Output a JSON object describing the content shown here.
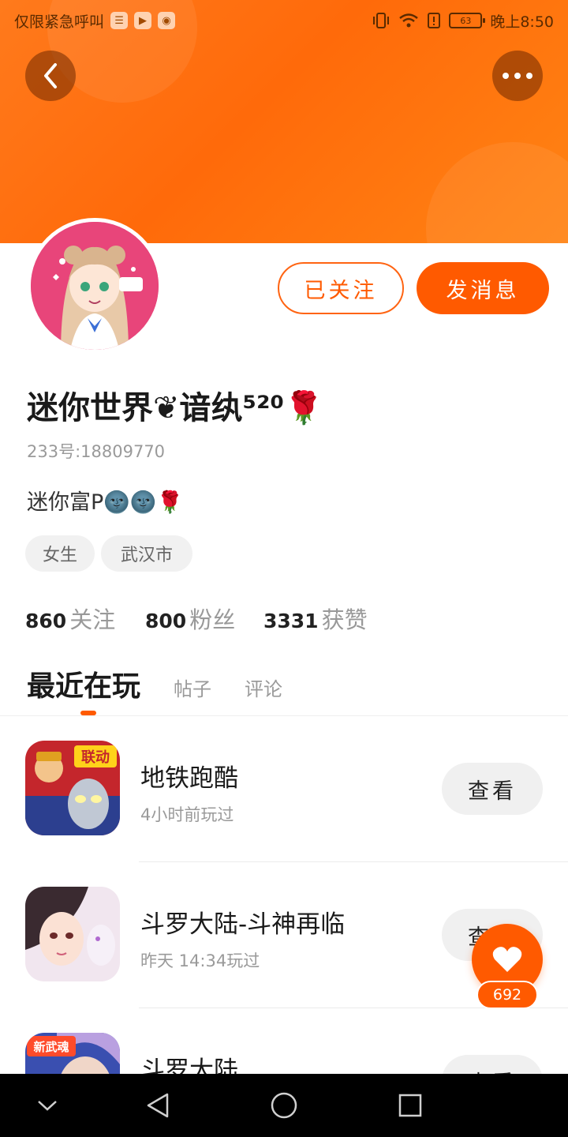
{
  "status_bar": {
    "carrier_text": "仅限紧急呼叫",
    "battery_level": "63",
    "time": "晚上8:50"
  },
  "profile": {
    "follow_state_label": "已关注",
    "message_label": "发消息",
    "nickname": "迷你世界❦谙纨⁵²⁰🌹",
    "uid": "233号:18809770",
    "bio": "迷你富P🌚🌚🌹",
    "tags": [
      "女生",
      "武汉市"
    ],
    "stats": {
      "following_count": "860",
      "following_label": "关注",
      "fans_count": "800",
      "fans_label": "粉丝",
      "likes_count": "3331",
      "likes_label": "获赞"
    }
  },
  "tabs": {
    "recent": "最近在玩",
    "posts": "帖子",
    "comments": "评论"
  },
  "games": [
    {
      "name": "地铁跑酷",
      "played": "4小时前玩过",
      "action": "查看",
      "icon_badge": "联动"
    },
    {
      "name": "斗罗大陆-斗神再临",
      "played": "昨天 14:34玩过",
      "action": "查看"
    },
    {
      "name": "斗罗大陆",
      "action": "查看",
      "icon_badge": "新武魂"
    }
  ],
  "floating_like": {
    "count": "692"
  },
  "colors": {
    "accent": "#ff5a00",
    "banner": "#ff7a1c"
  }
}
